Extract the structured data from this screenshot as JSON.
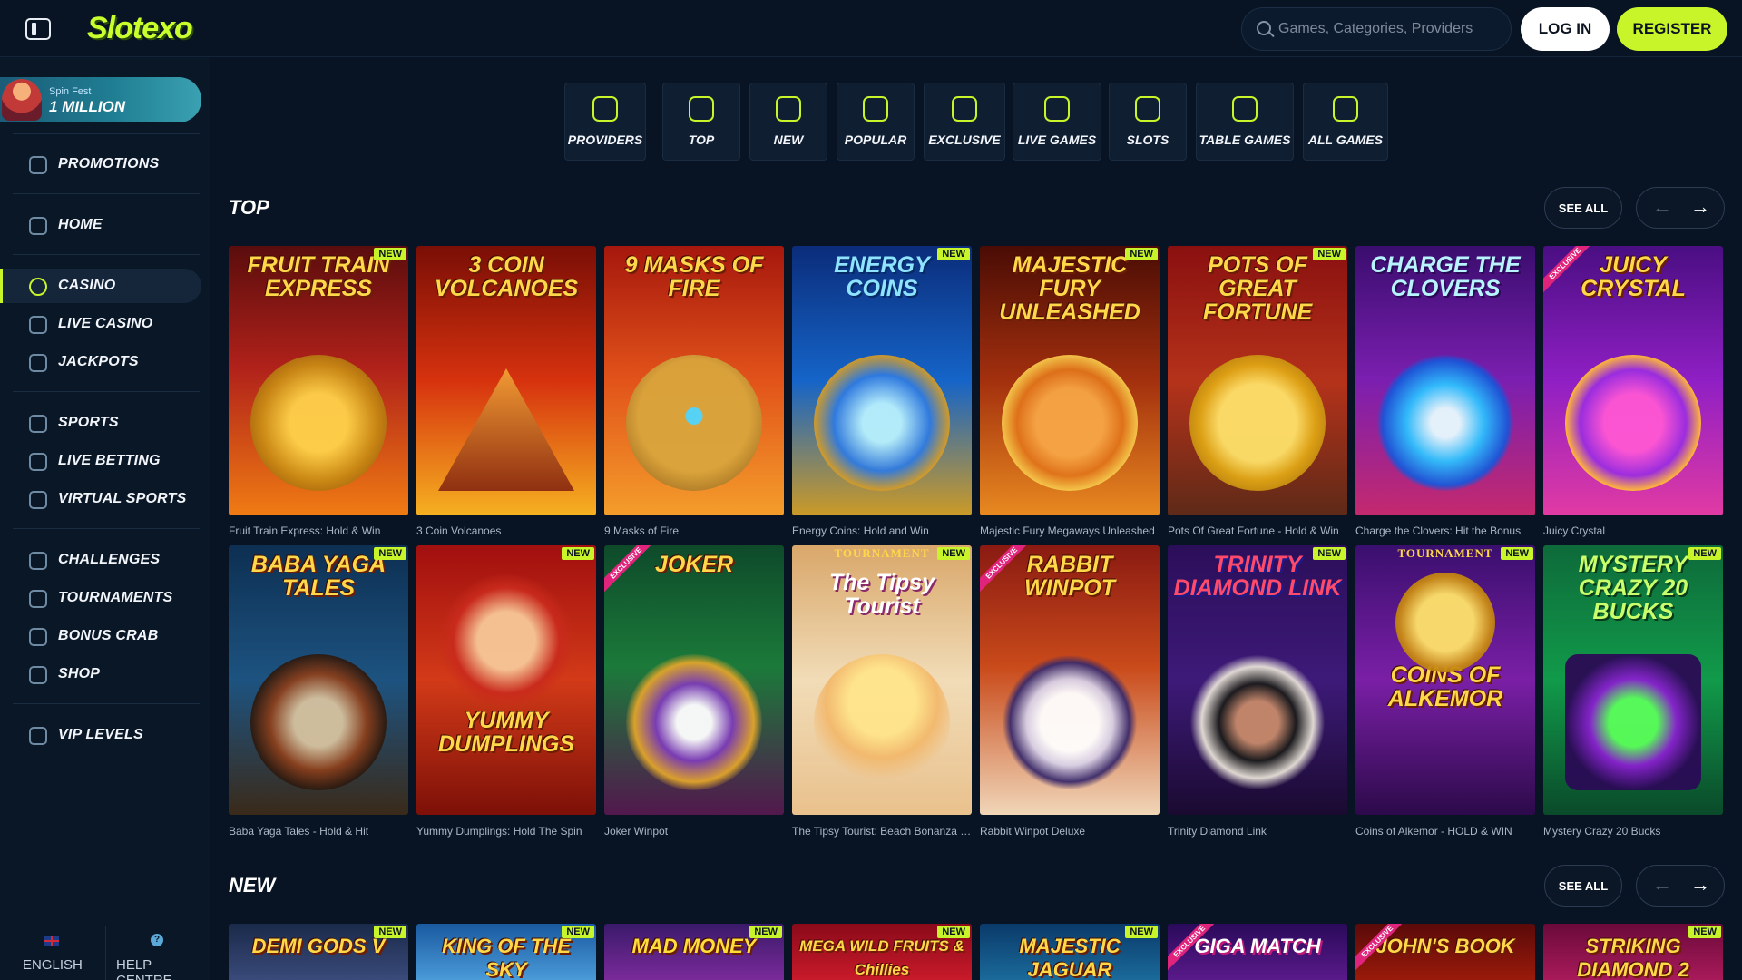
{
  "header": {
    "logo": "Slotexo",
    "search_placeholder": "Games, Categories, Providers",
    "login_label": "LOG IN",
    "register_label": "REGISTER"
  },
  "sidebar": {
    "promo": {
      "subtitle": "Spin Fest",
      "title": "1 MILLION"
    },
    "items": [
      {
        "label": "PROMOTIONS",
        "icon": "gift-icon"
      },
      {
        "label": "HOME",
        "icon": "home-icon"
      },
      {
        "label": "CASINO",
        "icon": "casino-chip-icon",
        "active": true
      },
      {
        "label": "LIVE CASINO",
        "icon": "live-casino-icon"
      },
      {
        "label": "JACKPOTS",
        "icon": "jackpot-7-icon"
      },
      {
        "label": "SPORTS",
        "icon": "football-icon"
      },
      {
        "label": "LIVE BETTING",
        "icon": "live-play-icon"
      },
      {
        "label": "VIRTUAL SPORTS",
        "icon": "gamepad-icon"
      },
      {
        "label": "CHALLENGES",
        "icon": "medal-icon"
      },
      {
        "label": "TOURNAMENTS",
        "icon": "trophy-icon"
      },
      {
        "label": "BONUS CRAB",
        "icon": "crab-icon"
      },
      {
        "label": "SHOP",
        "icon": "shop-icon"
      },
      {
        "label": "VIP LEVELS",
        "icon": "diamond-icon"
      }
    ],
    "footer": {
      "language": "ENGLISH",
      "help": "HELP CENTRE",
      "help_glyph": "?"
    }
  },
  "categories": [
    {
      "label": "PROVIDERS",
      "icon": "grid-icon"
    },
    {
      "label": "TOP",
      "icon": "award-icon"
    },
    {
      "label": "NEW",
      "icon": "rocket-icon"
    },
    {
      "label": "POPULAR",
      "icon": "flame-icon"
    },
    {
      "label": "EXCLUSIVE",
      "icon": "gem-icon"
    },
    {
      "label": "LIVE GAMES",
      "icon": "broadcast-icon"
    },
    {
      "label": "SLOTS",
      "icon": "slot-machine-icon"
    },
    {
      "label": "TABLE GAMES",
      "icon": "chip-icon"
    },
    {
      "label": "ALL GAMES",
      "icon": "cherries-icon"
    }
  ],
  "sections": {
    "top": {
      "title": "TOP",
      "see_all": "SEE ALL",
      "arrow_left": "←",
      "arrow_right": "→",
      "row1": [
        {
          "name": "Fruit Train Express: Hold & Win",
          "art": "FRUIT TRAIN EXPRESS",
          "badge": "NEW"
        },
        {
          "name": "3 Coin Volcanoes",
          "art": "3 COIN VOLCANOES",
          "badge": ""
        },
        {
          "name": "9 Masks of Fire",
          "art": "9 MASKS OF FIRE",
          "badge": ""
        },
        {
          "name": "Energy Coins: Hold and Win",
          "art": "ENERGY COINS",
          "badge": "NEW"
        },
        {
          "name": "Majestic Fury Megaways Unleashed",
          "art": "MAJESTIC FURY UNLEASHED",
          "badge": "NEW"
        },
        {
          "name": "Pots Of Great Fortune - Hold & Win",
          "art": "POTS OF GREAT FORTUNE",
          "badge": "NEW"
        },
        {
          "name": "Charge the Clovers: Hit the Bonus",
          "art": "CHARGE THE CLOVERS",
          "badge": ""
        },
        {
          "name": "Juicy Crystal",
          "art": "JUICY CRYSTAL",
          "badge": "EXCLUSIVE"
        }
      ],
      "row2": [
        {
          "name": "Baba Yaga Tales - Hold & Hit",
          "art": "BABA YAGA TALES",
          "badge": "NEW"
        },
        {
          "name": "Yummy Dumplings: Hold The Spin",
          "art": "YUMMY DUMPLINGS",
          "badge": "NEW"
        },
        {
          "name": "Joker Winpot",
          "art": "JOKER",
          "badge": "EXCLUSIVE"
        },
        {
          "name": "The Tipsy Tourist: Beach Bonanza - ...",
          "art": "The Tipsy Tourist",
          "badge": "NEW",
          "tour": "TOURNAMENT"
        },
        {
          "name": "Rabbit Winpot Deluxe",
          "art": "RABBIT WINPOT",
          "badge": "EXCLUSIVE"
        },
        {
          "name": "Trinity Diamond Link",
          "art": "TRINITY DIAMOND LINK",
          "badge": "NEW"
        },
        {
          "name": "Coins of Alkemor - HOLD & WIN",
          "art": "COINS OF ALKEMOR",
          "badge": "NEW",
          "tour": "TOURNAMENT"
        },
        {
          "name": "Mystery Crazy 20 Bucks",
          "art": "MYSTERY CRAZY 20 BUCKS",
          "badge": "NEW"
        }
      ]
    },
    "new": {
      "title": "NEW",
      "see_all": "SEE ALL",
      "arrow_left": "←",
      "arrow_right": "→",
      "row": [
        {
          "art": "DEMI GODS V",
          "badge": "NEW"
        },
        {
          "art": "KING OF THE SKY",
          "badge": "NEW"
        },
        {
          "art": "MAD MONEY",
          "badge": "NEW"
        },
        {
          "art": "MEGA WILD FRUITS & Chillies",
          "badge": "NEW"
        },
        {
          "art": "MAJESTIC JAGUAR",
          "badge": "NEW"
        },
        {
          "art": "GIGA MATCH",
          "badge": "EXCLUSIVE"
        },
        {
          "art": "JOHN'S BOOK",
          "badge": "EXCLUSIVE"
        },
        {
          "art": "STRIKING DIAMOND 2",
          "badge": "NEW"
        }
      ]
    }
  },
  "colors": {
    "accent": "#c7f52a",
    "background": "#081423",
    "sidebar": "#0a1727",
    "exclusive": "#e0247c"
  }
}
